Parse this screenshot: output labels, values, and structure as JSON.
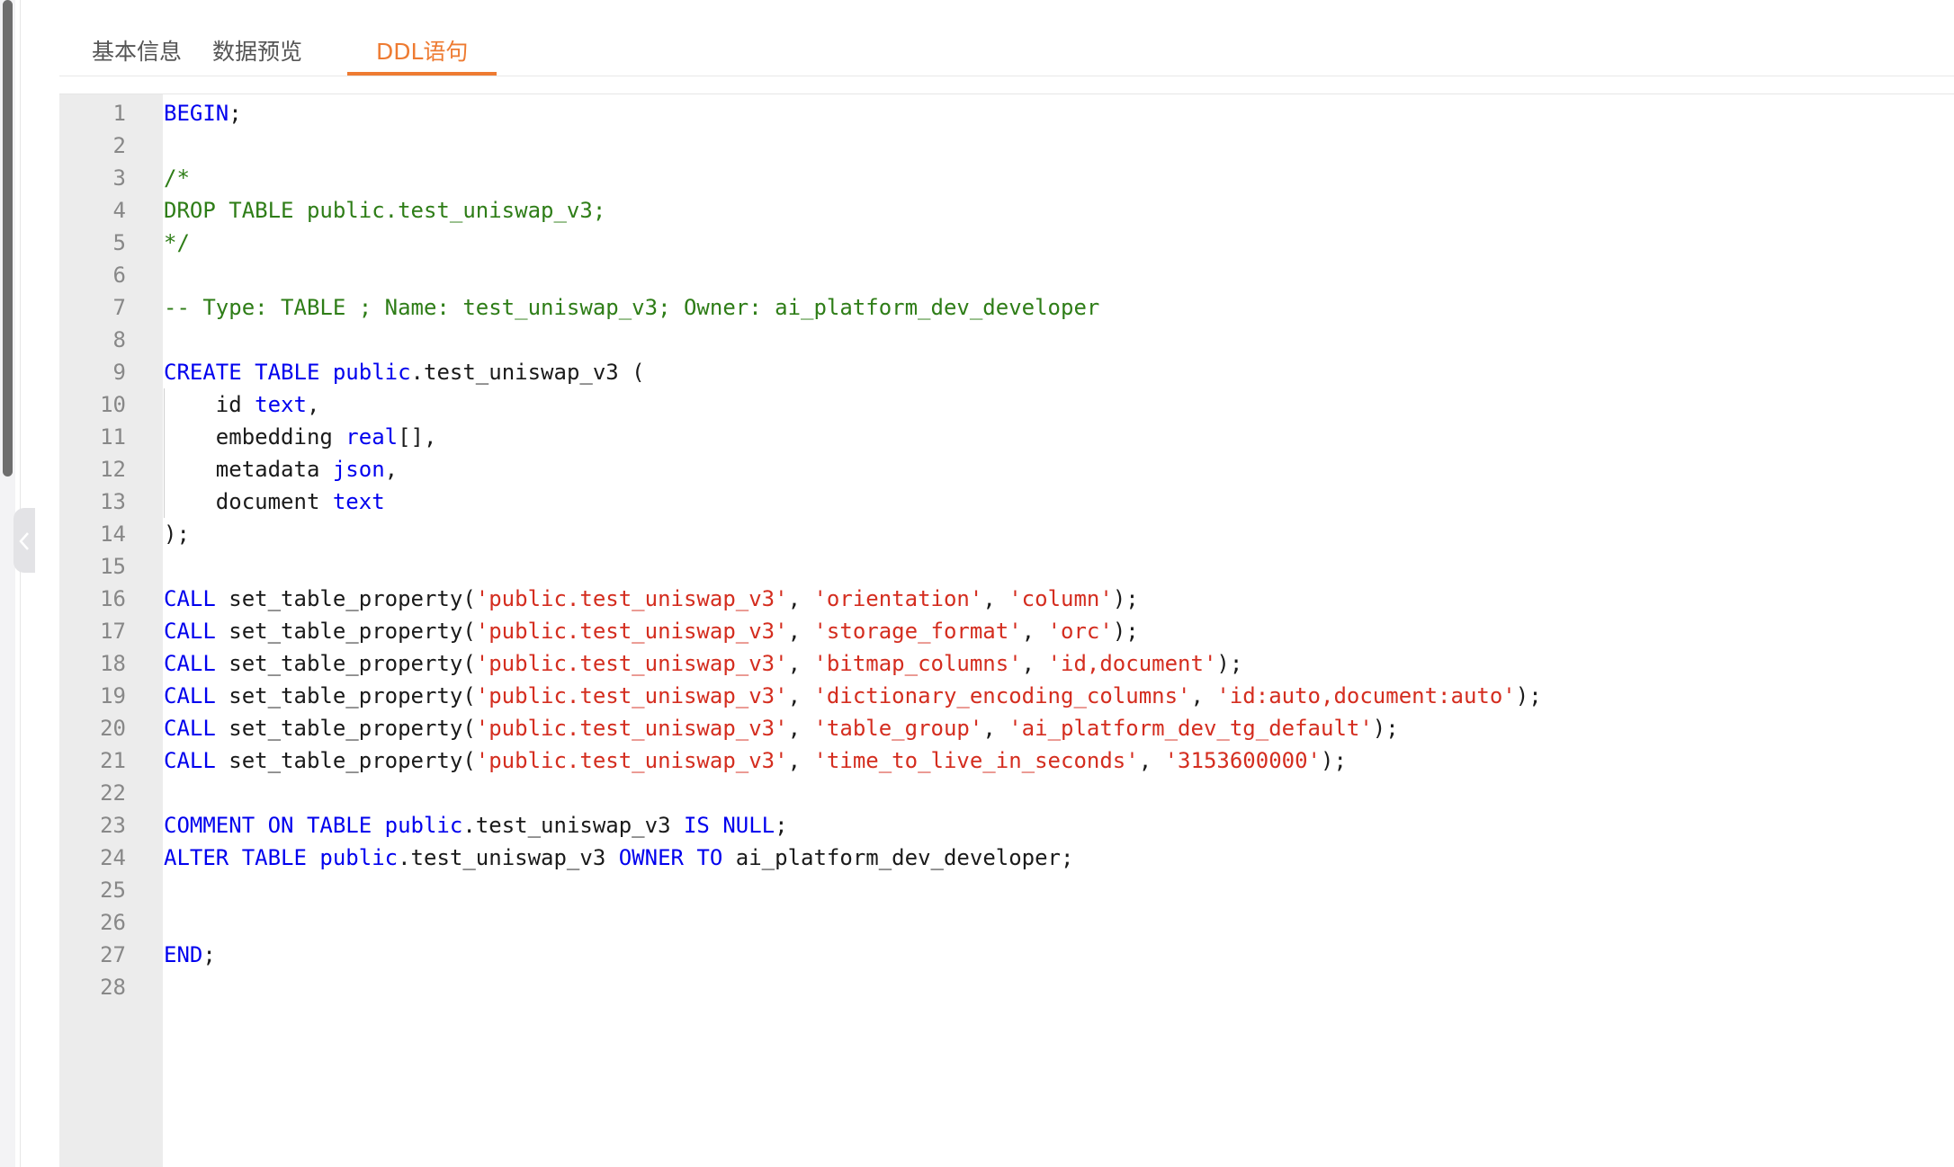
{
  "tabs": [
    {
      "label": "基本信息",
      "active": false
    },
    {
      "label": "数据预览",
      "active": false
    },
    {
      "label": "DDL语句",
      "active": true
    }
  ],
  "colors": {
    "accent": "#ee7b32",
    "keyword": "#0000ee",
    "comment": "#2e7d17",
    "string": "#d42d1f",
    "text": "#1a1a1a",
    "gutter": "#ececec"
  },
  "icons": {
    "collapse": "chevron-left-icon"
  },
  "editor": {
    "lines": [
      {
        "n": "1",
        "t": [
          {
            "k": "kw",
            "v": "BEGIN"
          },
          {
            "k": "",
            "v": ";"
          }
        ]
      },
      {
        "n": "2",
        "t": []
      },
      {
        "n": "3",
        "t": [
          {
            "k": "cm",
            "v": "/*"
          }
        ]
      },
      {
        "n": "4",
        "t": [
          {
            "k": "cm",
            "v": "DROP TABLE public.test_uniswap_v3;"
          }
        ]
      },
      {
        "n": "5",
        "t": [
          {
            "k": "cm",
            "v": "*/"
          }
        ]
      },
      {
        "n": "6",
        "t": []
      },
      {
        "n": "7",
        "t": [
          {
            "k": "cm",
            "v": "-- Type: TABLE ; Name: test_uniswap_v3; Owner: ai_platform_dev_developer"
          }
        ]
      },
      {
        "n": "8",
        "t": []
      },
      {
        "n": "9",
        "t": [
          {
            "k": "kw",
            "v": "CREATE TABLE public"
          },
          {
            "k": "",
            "v": ".test_uniswap_v3 ("
          }
        ]
      },
      {
        "n": "10",
        "t": [
          {
            "k": "",
            "v": "    id "
          },
          {
            "k": "kw",
            "v": "text"
          },
          {
            "k": "",
            "v": ","
          }
        ]
      },
      {
        "n": "11",
        "t": [
          {
            "k": "",
            "v": "    embedding "
          },
          {
            "k": "kw",
            "v": "real"
          },
          {
            "k": "",
            "v": "[],"
          }
        ]
      },
      {
        "n": "12",
        "t": [
          {
            "k": "",
            "v": "    metadata "
          },
          {
            "k": "kw",
            "v": "json"
          },
          {
            "k": "",
            "v": ","
          }
        ]
      },
      {
        "n": "13",
        "t": [
          {
            "k": "",
            "v": "    document "
          },
          {
            "k": "kw",
            "v": "text"
          }
        ]
      },
      {
        "n": "14",
        "t": [
          {
            "k": "",
            "v": ");"
          }
        ]
      },
      {
        "n": "15",
        "t": []
      },
      {
        "n": "16",
        "t": [
          {
            "k": "kw",
            "v": "CALL"
          },
          {
            "k": "",
            "v": " set_table_property("
          },
          {
            "k": "st",
            "v": "'public.test_uniswap_v3'"
          },
          {
            "k": "",
            "v": ", "
          },
          {
            "k": "st",
            "v": "'orientation'"
          },
          {
            "k": "",
            "v": ", "
          },
          {
            "k": "st",
            "v": "'column'"
          },
          {
            "k": "",
            "v": ");"
          }
        ]
      },
      {
        "n": "17",
        "t": [
          {
            "k": "kw",
            "v": "CALL"
          },
          {
            "k": "",
            "v": " set_table_property("
          },
          {
            "k": "st",
            "v": "'public.test_uniswap_v3'"
          },
          {
            "k": "",
            "v": ", "
          },
          {
            "k": "st",
            "v": "'storage_format'"
          },
          {
            "k": "",
            "v": ", "
          },
          {
            "k": "st",
            "v": "'orc'"
          },
          {
            "k": "",
            "v": ");"
          }
        ]
      },
      {
        "n": "18",
        "t": [
          {
            "k": "kw",
            "v": "CALL"
          },
          {
            "k": "",
            "v": " set_table_property("
          },
          {
            "k": "st",
            "v": "'public.test_uniswap_v3'"
          },
          {
            "k": "",
            "v": ", "
          },
          {
            "k": "st",
            "v": "'bitmap_columns'"
          },
          {
            "k": "",
            "v": ", "
          },
          {
            "k": "st",
            "v": "'id,document'"
          },
          {
            "k": "",
            "v": ");"
          }
        ]
      },
      {
        "n": "19",
        "t": [
          {
            "k": "kw",
            "v": "CALL"
          },
          {
            "k": "",
            "v": " set_table_property("
          },
          {
            "k": "st",
            "v": "'public.test_uniswap_v3'"
          },
          {
            "k": "",
            "v": ", "
          },
          {
            "k": "st",
            "v": "'dictionary_encoding_columns'"
          },
          {
            "k": "",
            "v": ", "
          },
          {
            "k": "st",
            "v": "'id:auto,document:auto'"
          },
          {
            "k": "",
            "v": ");"
          }
        ]
      },
      {
        "n": "20",
        "t": [
          {
            "k": "kw",
            "v": "CALL"
          },
          {
            "k": "",
            "v": " set_table_property("
          },
          {
            "k": "st",
            "v": "'public.test_uniswap_v3'"
          },
          {
            "k": "",
            "v": ", "
          },
          {
            "k": "st",
            "v": "'table_group'"
          },
          {
            "k": "",
            "v": ", "
          },
          {
            "k": "st",
            "v": "'ai_platform_dev_tg_default'"
          },
          {
            "k": "",
            "v": ");"
          }
        ]
      },
      {
        "n": "21",
        "t": [
          {
            "k": "kw",
            "v": "CALL"
          },
          {
            "k": "",
            "v": " set_table_property("
          },
          {
            "k": "st",
            "v": "'public.test_uniswap_v3'"
          },
          {
            "k": "",
            "v": ", "
          },
          {
            "k": "st",
            "v": "'time_to_live_in_seconds'"
          },
          {
            "k": "",
            "v": ", "
          },
          {
            "k": "st",
            "v": "'3153600000'"
          },
          {
            "k": "",
            "v": ");"
          }
        ]
      },
      {
        "n": "22",
        "t": []
      },
      {
        "n": "23",
        "t": [
          {
            "k": "kw",
            "v": "COMMENT ON TABLE public"
          },
          {
            "k": "",
            "v": ".test_uniswap_v3 "
          },
          {
            "k": "kw",
            "v": "IS NULL"
          },
          {
            "k": "",
            "v": ";"
          }
        ]
      },
      {
        "n": "24",
        "t": [
          {
            "k": "kw",
            "v": "ALTER TABLE public"
          },
          {
            "k": "",
            "v": ".test_uniswap_v3 "
          },
          {
            "k": "kw",
            "v": "OWNER TO"
          },
          {
            "k": "",
            "v": " ai_platform_dev_developer;"
          }
        ]
      },
      {
        "n": "25",
        "t": []
      },
      {
        "n": "26",
        "t": []
      },
      {
        "n": "27",
        "t": [
          {
            "k": "kw",
            "v": "END"
          },
          {
            "k": "",
            "v": ";"
          }
        ]
      },
      {
        "n": "28",
        "t": []
      }
    ]
  }
}
